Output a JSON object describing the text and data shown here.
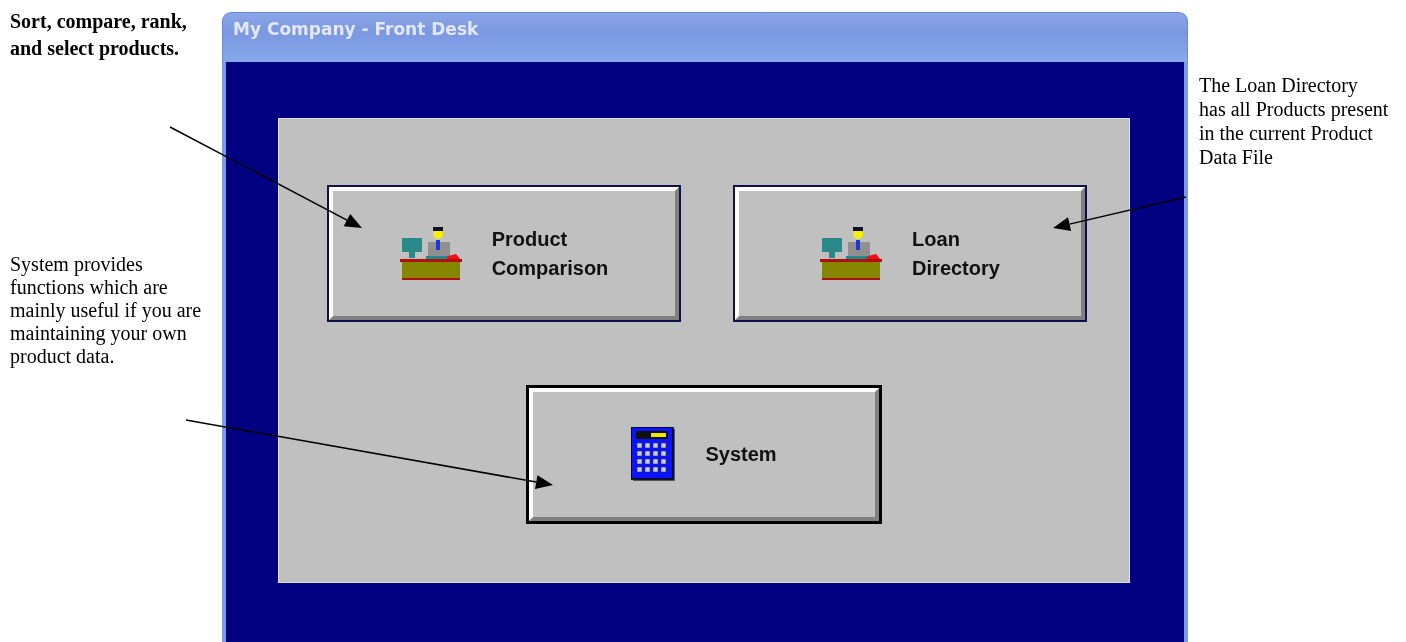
{
  "annotations": {
    "left_top": "Sort, compare, rank, and select products.",
    "left_bottom": "System provides functions which are mainly useful if you are maintaining your own product data.",
    "right": "The Loan Directory has all Products present in the current Product  Data File"
  },
  "window": {
    "title": "My Company - Front Desk"
  },
  "buttons": [
    {
      "label": "Product Comparison",
      "kind": "desk"
    },
    {
      "label": "Loan Directory",
      "kind": "desk"
    },
    {
      "label": "System",
      "kind": "calculator"
    }
  ]
}
